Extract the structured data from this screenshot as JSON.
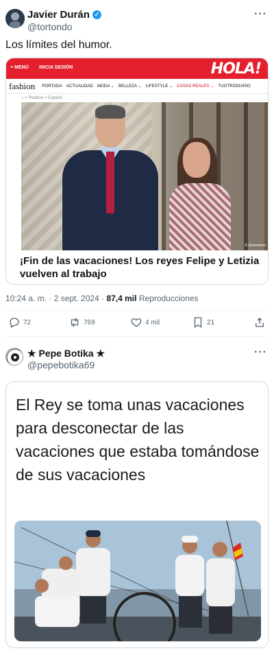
{
  "tweet1": {
    "author_name": "Javier Durán",
    "verified_mark": "✓",
    "handle": "@tortondo",
    "more_label": "···",
    "text": "Los límites del humor.",
    "card": {
      "site_menu": "≡ MENÚ",
      "site_login": "INICIA SESIÓN",
      "site_logo": "HOLA!",
      "site_fashion": "fashion",
      "nav_items": [
        "PORTADA",
        "ACTUALIDAD",
        "MODA ⌄",
        "BELLEZA ⌄",
        "LIFESTYLE ⌄",
        "CASAS REALES ⌄",
        "TUOTRODIARIO"
      ],
      "breadcrumb": "⌂ > Realeza > España",
      "photo_credit": "© Gtresonline",
      "headline": "¡Fin de las vacaciones! Los reyes Felipe y Letizia vuelven al trabajo"
    },
    "time": "10:24 a. m. · 2 sept. 2024 ·",
    "views_count": "87,4 mil",
    "views_label": "Reproducciones",
    "replies": "72",
    "retweets": "769",
    "likes": "4 mil",
    "bookmarks": "21"
  },
  "tweet2": {
    "author_name": "★ Pepe Botika ★",
    "handle": "@pepebotika69",
    "more_label": "···",
    "meme_text": "El Rey se toma unas vacaciones para desconectar de las vacaciones que estaba tomándose de sus vacaciones"
  },
  "colors": {
    "hola_red": "#e4202e",
    "verified_blue": "#1d9bf0",
    "secondary_text": "#536471"
  }
}
